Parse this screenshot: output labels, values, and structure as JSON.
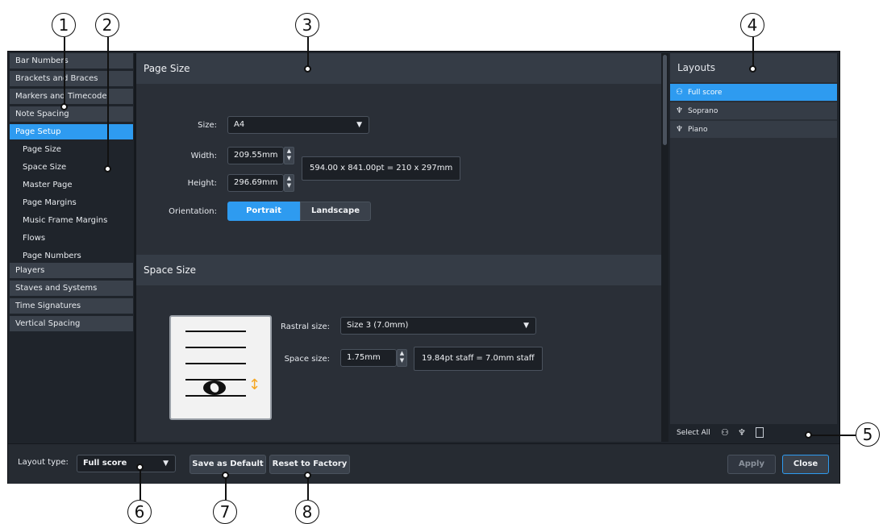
{
  "callouts": [
    "1",
    "2",
    "3",
    "4",
    "5",
    "6",
    "7",
    "8"
  ],
  "sidebar": {
    "categories_top": [
      "Bar Numbers",
      "Brackets and Braces",
      "Markers and Timecode",
      "Note Spacing"
    ],
    "active": "Page Setup",
    "subitems": [
      "Page Size",
      "Space Size",
      "Master Page",
      "Page Margins",
      "Music Frame Margins",
      "Flows",
      "Page Numbers"
    ],
    "categories_bottom": [
      "Players",
      "Staves and Systems",
      "Time Signatures",
      "Vertical Spacing"
    ]
  },
  "page_size": {
    "title": "Page Size",
    "size_label": "Size:",
    "size_value": "A4",
    "width_label": "Width:",
    "width_value": "209.55mm",
    "height_label": "Height:",
    "height_value": "296.69mm",
    "dimensions_info": "594.00 x 841.00pt = 210 x 297mm",
    "orientation_label": "Orientation:",
    "portrait": "Portrait",
    "landscape": "Landscape"
  },
  "space_size": {
    "title": "Space Size",
    "rastral_label": "Rastral size:",
    "rastral_value": "Size 3 (7.0mm)",
    "space_label": "Space size:",
    "space_value": "1.75mm",
    "staff_info": "19.84pt staff = 7.0mm staff"
  },
  "layouts": {
    "title": "Layouts",
    "items": [
      {
        "name": "Full score",
        "icon": "full-score-icon",
        "glyph": "⚇"
      },
      {
        "name": "Soprano",
        "icon": "part-icon",
        "glyph": "♆"
      },
      {
        "name": "Piano",
        "icon": "part-icon",
        "glyph": "♆"
      }
    ],
    "select_all": "Select All"
  },
  "bottom": {
    "layout_type_label": "Layout type:",
    "layout_type_value": "Full score",
    "save_default": "Save as Default",
    "reset_factory": "Reset to Factory",
    "apply": "Apply",
    "close": "Close"
  },
  "colors": {
    "accent": "#2e9bf0",
    "background": "#1f242b",
    "panel": "#2a2f37",
    "header": "#353c46",
    "arrow": "#f5a623"
  }
}
